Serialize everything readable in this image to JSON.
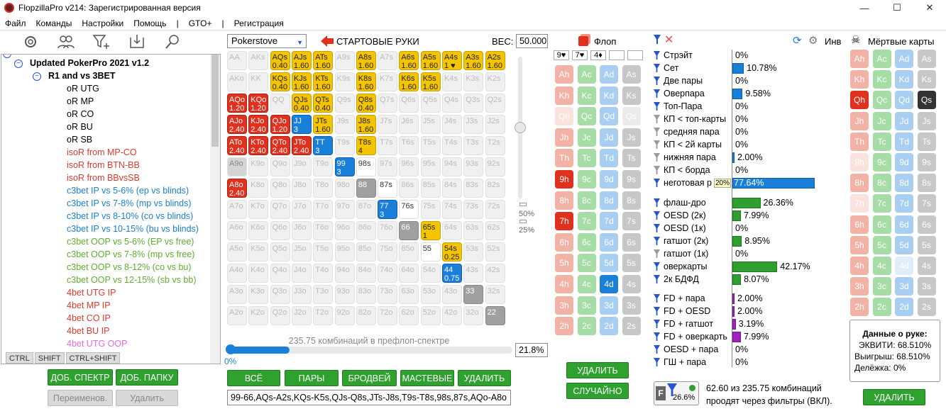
{
  "window": {
    "title": "FlopzillaPro v214: Зарегистрированная версия"
  },
  "menu": [
    "Файл",
    "Команды",
    "Настройки",
    "Помощь",
    "|",
    "GTO+",
    "|",
    "Регистрация"
  ],
  "tree": {
    "items": [
      {
        "label": "Updated PokerPro 2021 v1.2",
        "color": "#000",
        "bold": true,
        "indent": 40
      },
      {
        "label": "R1 and vs 3BET",
        "color": "#000",
        "bold": true,
        "indent": 66
      },
      {
        "label": "oR UTG",
        "color": "#000",
        "indent": 92
      },
      {
        "label": "oR MP",
        "color": "#000",
        "indent": 92
      },
      {
        "label": "oR CO",
        "color": "#000",
        "indent": 92
      },
      {
        "label": "oR BU",
        "color": "#000",
        "indent": 92
      },
      {
        "label": "oR SB",
        "color": "#000",
        "indent": 92
      },
      {
        "label": "isoR from MP-CO",
        "color": "#d93c2c",
        "indent": 92
      },
      {
        "label": "isoR from BTN-BB",
        "color": "#d93c2c",
        "indent": 92
      },
      {
        "label": "isoR from BBvsSB",
        "color": "#d93c2c",
        "indent": 92
      },
      {
        "label": "c3bet IP vs 5-6% (ep vs blinds)",
        "color": "#1c7fd0",
        "indent": 92
      },
      {
        "label": "c3bet IP vs 7-8% (mp vs blinds)",
        "color": "#1c7fd0",
        "indent": 92
      },
      {
        "label": "c3bet IP vs 8-10% (co vs blinds)",
        "color": "#1c7fd0",
        "indent": 92
      },
      {
        "label": "c3bet IP vs 10-15% (bu vs blinds)",
        "color": "#1c7fd0",
        "indent": 92
      },
      {
        "label": "c3bet OOP vs 5-6% (EP vs free)",
        "color": "#5fae2f",
        "indent": 92
      },
      {
        "label": "c3bet OOP vs 7-8% (mp vs free)",
        "color": "#5fae2f",
        "indent": 92
      },
      {
        "label": "c3bet OOP vs 8-12% (co vs bu)",
        "color": "#5fae2f",
        "indent": 92
      },
      {
        "label": "c3bet OOP vs 12-15% (sb vs bb)",
        "color": "#5fae2f",
        "indent": 92
      },
      {
        "label": "4bet UTG IP",
        "color": "#d93c2c",
        "indent": 92
      },
      {
        "label": "4bet MP IP",
        "color": "#d93c2c",
        "indent": 92
      },
      {
        "label": "4bet CO IP",
        "color": "#d93c2c",
        "indent": 92
      },
      {
        "label": "4bet BU IP",
        "color": "#d93c2c",
        "indent": 92
      },
      {
        "label": "4bet UTG OOP",
        "color": "#e36be0",
        "indent": 92
      }
    ]
  },
  "ctrl": [
    "CTRL",
    "SHIFT",
    "CTRL+SHIFT"
  ],
  "left_buttons": {
    "add_spectrum": "ДОБ. СПЕКТР",
    "add_folder": "ДОБ. ПАПКУ",
    "rename": "Переименов.",
    "delete": "Удалить"
  },
  "range": {
    "source": "Pokerstove",
    "title": "СТАРТОВЫЕ РУКИ",
    "weight_label": "ВЕС:",
    "weight_value": "50.000",
    "slider_pct_top": "50%",
    "slider_pct_bottom": "25%",
    "combos_text": "235.75 комбинаций в префлоп-спектре",
    "progress_pct": "21.8%",
    "progress_left": "0%",
    "progress_fill": 0.218,
    "buttons": [
      "ВСЁ",
      "ПАРЫ",
      "БРОДВЕЙ",
      "МАСТЕВЫЕ",
      "УДАЛИТЬ"
    ],
    "text": "99-66,AQs-A2s,KQs-K5s,QJs-Q8s,JTs-J8s,T9s-T8s,98s,87s,AQo-A8o"
  },
  "matrix": [
    [
      [
        "AA",
        "",
        ""
      ],
      [
        "AKs",
        "",
        ""
      ],
      [
        "AQs",
        "0.40",
        "y"
      ],
      [
        "AJs",
        "1.60",
        "y"
      ],
      [
        "ATs",
        "1.60",
        "y"
      ],
      [
        "A9s",
        "",
        ""
      ],
      [
        "A8s",
        "1.60",
        "y"
      ],
      [
        "A7s",
        "",
        ""
      ],
      [
        "A6s",
        "1.60",
        "y"
      ],
      [
        "A5s",
        "1.60",
        "y"
      ],
      [
        "A4s",
        "1 ♥",
        "y"
      ],
      [
        "A3s",
        "1.60",
        "y"
      ],
      [
        "A2s",
        "1.60",
        "y"
      ]
    ],
    [
      [
        "AKo",
        "",
        ""
      ],
      [
        "KK",
        "",
        ""
      ],
      [
        "KQs",
        "0.40",
        "y"
      ],
      [
        "KJs",
        "1.60",
        "y"
      ],
      [
        "KTs",
        "1.60",
        "y"
      ],
      [
        "K9s",
        "",
        ""
      ],
      [
        "K8s",
        "1.60",
        "y"
      ],
      [
        "K7s",
        "",
        ""
      ],
      [
        "K6s",
        "1.60",
        "y"
      ],
      [
        "K5s",
        "1.60",
        "y"
      ],
      [
        "K4s",
        "",
        ""
      ],
      [
        "K3s",
        "",
        ""
      ],
      [
        "K2s",
        "",
        ""
      ]
    ],
    [
      [
        "AQo",
        "1.20",
        "r"
      ],
      [
        "KQo",
        "1.20",
        "r"
      ],
      [
        "QQ",
        "",
        ""
      ],
      [
        "QJs",
        "0.40",
        "y"
      ],
      [
        "QTs",
        "0.40",
        "y"
      ],
      [
        "Q9s",
        "",
        ""
      ],
      [
        "Q8s",
        "0.40",
        "y"
      ],
      [
        "Q7s",
        "",
        ""
      ],
      [
        "Q6s",
        "",
        ""
      ],
      [
        "Q5s",
        "",
        ""
      ],
      [
        "Q4s",
        "",
        ""
      ],
      [
        "Q3s",
        "",
        ""
      ],
      [
        "Q2s",
        "",
        ""
      ]
    ],
    [
      [
        "AJo",
        "2.40",
        "r"
      ],
      [
        "KJo",
        "2.40",
        "r"
      ],
      [
        "QJo",
        "1.20",
        "r"
      ],
      [
        "JJ",
        "3",
        "b"
      ],
      [
        "JTs",
        "1.60",
        "y"
      ],
      [
        "J9s",
        "",
        ""
      ],
      [
        "J8s",
        "1.60",
        "y"
      ],
      [
        "J7s",
        "",
        ""
      ],
      [
        "J6s",
        "",
        ""
      ],
      [
        "J5s",
        "",
        ""
      ],
      [
        "J4s",
        "",
        ""
      ],
      [
        "J3s",
        "",
        ""
      ],
      [
        "J2s",
        "",
        ""
      ]
    ],
    [
      [
        "ATo",
        "2.40",
        "r"
      ],
      [
        "KTo",
        "2.40",
        "r"
      ],
      [
        "QTo",
        "2.40",
        "r"
      ],
      [
        "JTo",
        "2.40",
        "r"
      ],
      [
        "TT",
        "3",
        "b"
      ],
      [
        "T9s",
        "",
        ""
      ],
      [
        "T8s",
        "4",
        "y"
      ],
      [
        "T7s",
        "",
        ""
      ],
      [
        "T6s",
        "",
        ""
      ],
      [
        "T5s",
        "",
        ""
      ],
      [
        "T4s",
        "",
        ""
      ],
      [
        "T3s",
        "",
        ""
      ],
      [
        "T2s",
        "",
        ""
      ]
    ],
    [
      [
        "A9o",
        "",
        "lg"
      ],
      [
        "K9o",
        "",
        ""
      ],
      [
        "Q9o",
        "",
        ""
      ],
      [
        "J9o",
        "",
        ""
      ],
      [
        "T9o",
        "",
        ""
      ],
      [
        "99",
        "3",
        "b"
      ],
      [
        "98s",
        "",
        "wht"
      ],
      [
        "97s",
        "",
        ""
      ],
      [
        "96s",
        "",
        ""
      ],
      [
        "95s",
        "",
        ""
      ],
      [
        "94s",
        "",
        ""
      ],
      [
        "93s",
        "",
        ""
      ],
      [
        "92s",
        "",
        ""
      ]
    ],
    [
      [
        "A8o",
        "2.40",
        "r"
      ],
      [
        "K8o",
        "",
        ""
      ],
      [
        "Q8o",
        "",
        ""
      ],
      [
        "J8o",
        "",
        ""
      ],
      [
        "T8o",
        "",
        ""
      ],
      [
        "98o",
        "",
        ""
      ],
      [
        "88",
        "",
        "g"
      ],
      [
        "87s",
        "",
        "wht"
      ],
      [
        "86s",
        "",
        ""
      ],
      [
        "85s",
        "",
        ""
      ],
      [
        "84s",
        "",
        ""
      ],
      [
        "83s",
        "",
        ""
      ],
      [
        "82s",
        "",
        ""
      ]
    ],
    [
      [
        "A7o",
        "",
        ""
      ],
      [
        "K7o",
        "",
        ""
      ],
      [
        "Q7o",
        "",
        ""
      ],
      [
        "J7o",
        "",
        ""
      ],
      [
        "T7o",
        "",
        ""
      ],
      [
        "97o",
        "",
        ""
      ],
      [
        "87o",
        "",
        ""
      ],
      [
        "77",
        "3",
        "b"
      ],
      [
        "76s",
        "",
        "wht"
      ],
      [
        "75s",
        "",
        ""
      ],
      [
        "74s",
        "",
        ""
      ],
      [
        "73s",
        "",
        ""
      ],
      [
        "72s",
        "",
        ""
      ]
    ],
    [
      [
        "A6o",
        "",
        ""
      ],
      [
        "K6o",
        "",
        ""
      ],
      [
        "Q6o",
        "",
        ""
      ],
      [
        "J6o",
        "",
        ""
      ],
      [
        "T6o",
        "",
        ""
      ],
      [
        "96o",
        "",
        ""
      ],
      [
        "86o",
        "",
        ""
      ],
      [
        "76o",
        "",
        ""
      ],
      [
        "66",
        "",
        "g"
      ],
      [
        "65s",
        "1",
        "y"
      ],
      [
        "64s",
        "",
        ""
      ],
      [
        "63s",
        "",
        ""
      ],
      [
        "62s",
        "",
        ""
      ]
    ],
    [
      [
        "A5o",
        "",
        ""
      ],
      [
        "K5o",
        "",
        ""
      ],
      [
        "Q5o",
        "",
        ""
      ],
      [
        "J5o",
        "",
        ""
      ],
      [
        "T5o",
        "",
        ""
      ],
      [
        "95o",
        "",
        ""
      ],
      [
        "85o",
        "",
        ""
      ],
      [
        "75o",
        "",
        ""
      ],
      [
        "65o",
        "",
        ""
      ],
      [
        "55",
        "",
        "wht"
      ],
      [
        "54s",
        "0.25",
        "y"
      ],
      [
        "53s",
        "",
        ""
      ],
      [
        "52s",
        "",
        ""
      ]
    ],
    [
      [
        "A4o",
        "",
        ""
      ],
      [
        "K4o",
        "",
        ""
      ],
      [
        "Q4o",
        "",
        ""
      ],
      [
        "J4o",
        "",
        ""
      ],
      [
        "T4o",
        "",
        ""
      ],
      [
        "94o",
        "",
        ""
      ],
      [
        "84o",
        "",
        ""
      ],
      [
        "74o",
        "",
        ""
      ],
      [
        "64o",
        "",
        ""
      ],
      [
        "54o",
        "",
        ""
      ],
      [
        "44",
        "0.75",
        "b"
      ],
      [
        "43s",
        "",
        ""
      ],
      [
        "42s",
        "",
        ""
      ]
    ],
    [
      [
        "A3o",
        "",
        ""
      ],
      [
        "K3o",
        "",
        ""
      ],
      [
        "Q3o",
        "",
        ""
      ],
      [
        "J3o",
        "",
        ""
      ],
      [
        "T3o",
        "",
        ""
      ],
      [
        "93o",
        "",
        ""
      ],
      [
        "83o",
        "",
        ""
      ],
      [
        "73o",
        "",
        ""
      ],
      [
        "63o",
        "",
        ""
      ],
      [
        "53o",
        "",
        ""
      ],
      [
        "43o",
        "",
        ""
      ],
      [
        "33",
        "",
        "g"
      ],
      [
        "32s",
        "",
        ""
      ]
    ],
    [
      [
        "A2o",
        "",
        ""
      ],
      [
        "K2o",
        "",
        ""
      ],
      [
        "Q2o",
        "",
        ""
      ],
      [
        "J2o",
        "",
        ""
      ],
      [
        "T2o",
        "",
        ""
      ],
      [
        "92o",
        "",
        ""
      ],
      [
        "82o",
        "",
        ""
      ],
      [
        "72o",
        "",
        ""
      ],
      [
        "62o",
        "",
        ""
      ],
      [
        "52o",
        "",
        ""
      ],
      [
        "42o",
        "",
        ""
      ],
      [
        "32o",
        "",
        ""
      ],
      [
        "22",
        "",
        "g"
      ]
    ]
  ],
  "flop": {
    "title": "Флоп",
    "slots": [
      "9♥",
      "7♥",
      "4♦",
      "",
      ""
    ],
    "ranks": [
      "A",
      "K",
      "Q",
      "J",
      "T",
      "9",
      "8",
      "7",
      "6",
      "5",
      "4",
      "3",
      "2"
    ],
    "selected": [
      "9h",
      "7h",
      "4d"
    ],
    "delete": "УДАЛИТЬ",
    "random": "СЛУЧАЙНО"
  },
  "stats": {
    "inv": "Инв",
    "made": [
      {
        "label": "Стрэйт",
        "value": "0%",
        "pct": 0,
        "color": "#1a7fd8",
        "f": "b"
      },
      {
        "label": "Сет",
        "value": "10.78%",
        "pct": 10.78,
        "color": "#1a7fd8",
        "f": "b"
      },
      {
        "label": "Две пары",
        "value": "0%",
        "pct": 0,
        "color": "#1a7fd8",
        "f": "b"
      },
      {
        "label": "Оверпара",
        "value": "9.58%",
        "pct": 9.58,
        "color": "#1a7fd8",
        "f": "b"
      },
      {
        "label": "Топ-Пара",
        "value": "0%",
        "pct": 0,
        "color": "#1a7fd8",
        "f": "b"
      },
      {
        "label": "КП < топ-карты",
        "value": "0%",
        "pct": 0,
        "color": "#1a7fd8",
        "f": "g"
      },
      {
        "label": "средняя пара",
        "value": "0%",
        "pct": 0,
        "color": "#1a7fd8",
        "f": "g"
      },
      {
        "label": "КП < 2й карты",
        "value": "0%",
        "pct": 0,
        "color": "#1a7fd8",
        "f": "g"
      },
      {
        "label": "нижняя пара",
        "value": "2.00%",
        "pct": 2.0,
        "color": "#1a7fd8",
        "f": "g"
      },
      {
        "label": "КП < борда",
        "value": "0%",
        "pct": 0,
        "color": "#1a7fd8",
        "f": "g"
      },
      {
        "label": "неготовая р",
        "value": "77.64%",
        "pct": 77.64,
        "color": "#1a7fd8",
        "f": "b"
      }
    ],
    "tooltip": "20%",
    "draws": [
      {
        "label": "флаш-дро",
        "value": "26.36%",
        "pct": 26.36,
        "color": "#2e9e2e",
        "f": "b"
      },
      {
        "label": "OESD (2к)",
        "value": "7.99%",
        "pct": 7.99,
        "color": "#2e9e2e",
        "f": "b"
      },
      {
        "label": "OESD (1к)",
        "value": "0%",
        "pct": 0,
        "color": "#2e9e2e",
        "f": "b"
      },
      {
        "label": "гатшот (2к)",
        "value": "8.95%",
        "pct": 8.95,
        "color": "#2e9e2e",
        "f": "b"
      },
      {
        "label": "гатшот (1к)",
        "value": "0%",
        "pct": 0,
        "color": "#2e9e2e",
        "f": "g"
      },
      {
        "label": "оверкарты",
        "value": "42.17%",
        "pct": 42.17,
        "color": "#2e9e2e",
        "f": "b"
      },
      {
        "label": "2к БДФД",
        "value": "8.07%",
        "pct": 8.07,
        "color": "#2e9e2e",
        "f": "b"
      }
    ],
    "combos": [
      {
        "label": "FD + пара",
        "value": "2.00%",
        "pct": 2.0,
        "color": "#a020c0",
        "f": "b"
      },
      {
        "label": "FD + OESD",
        "value": "2.00%",
        "pct": 2.0,
        "color": "#a020c0",
        "f": "b"
      },
      {
        "label": "FD + гатшот",
        "value": "3.19%",
        "pct": 3.19,
        "color": "#a020c0",
        "f": "b"
      },
      {
        "label": "FD + оверкарть",
        "value": "7.99%",
        "pct": 7.99,
        "color": "#a020c0",
        "f": "b"
      },
      {
        "label": "OESD + пара",
        "value": "0%",
        "pct": 0,
        "color": "#a020c0",
        "f": "b"
      },
      {
        "label": "ГШ + пара",
        "value": "0%",
        "pct": 0,
        "color": "#a020c0",
        "f": "b"
      }
    ],
    "filter_pct": "26.6%",
    "filter_text1": "62.60 из 235.75 комбинаций",
    "filter_text2": "проодят через фильтры (ВКЛ)."
  },
  "dead": {
    "title": "Мёртвые карты",
    "selected": [
      "Qh",
      "Qs"
    ],
    "info_title": "Данные о руке:",
    "equity": "ЭКВИТИ: 68.510%",
    "win": "Выигрыш: 68.510%",
    "split": "Делёжка: 0%",
    "delete": "УДАЛИТЬ"
  }
}
